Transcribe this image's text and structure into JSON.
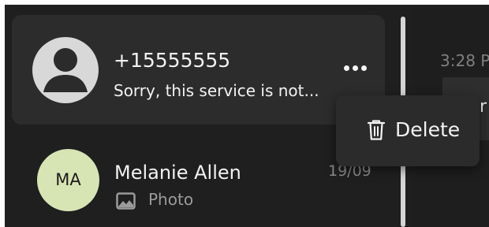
{
  "conversations": [
    {
      "name": "+15555555",
      "snippet": "Sorry, this service is not...",
      "avatar": "person-icon",
      "selected": true
    },
    {
      "name": "Melanie Allen",
      "initials": "MA",
      "date": "19/09",
      "snippet_icon": "photo-icon",
      "snippet": "Photo",
      "avatar_color": "#d7e5b4"
    }
  ],
  "more_button": {
    "icon": "more-horizontal-icon"
  },
  "context_menu": {
    "items": [
      {
        "icon": "trash-icon",
        "label": "Delete"
      }
    ]
  },
  "chat_pane": {
    "timestamp": "3:28 P",
    "bubble_text": "r"
  },
  "colors": {
    "background": "#1f1f1f",
    "selected_row": "#2c2c2c",
    "menu": "#2b2b2b",
    "text": "#f2f2f2",
    "muted_text": "#8a8a8a"
  }
}
